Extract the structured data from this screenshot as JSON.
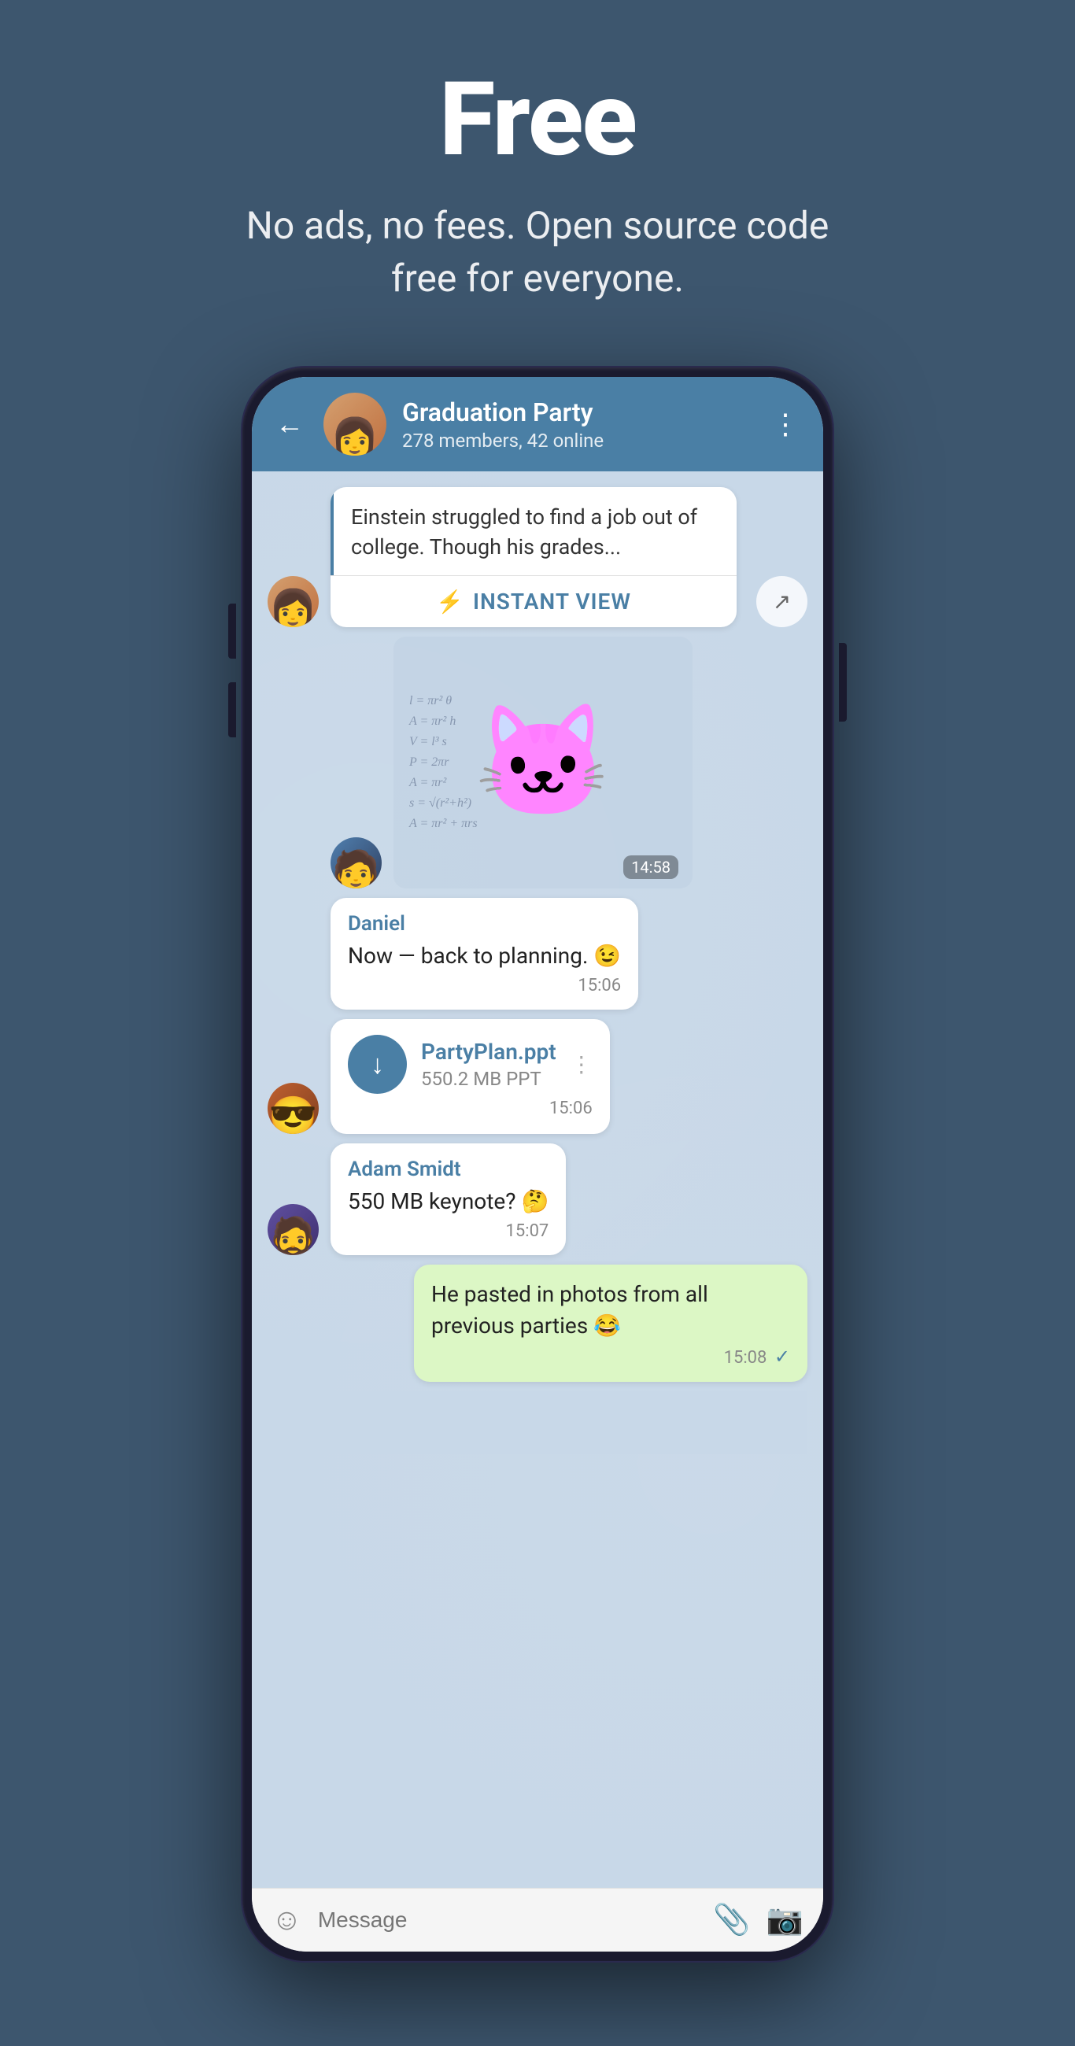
{
  "hero": {
    "title": "Free",
    "subtitle": "No ads, no fees. Open source code free for everyone."
  },
  "phone": {
    "header": {
      "group_name": "Graduation Party",
      "members_info": "278 members, 42 online",
      "back_label": "←",
      "more_label": "⋮"
    },
    "messages": [
      {
        "id": "article-msg",
        "type": "article",
        "avatar": "female",
        "article_text": "Einstein struggled to find a job out of college. Though his grades...",
        "instant_view_label": "INSTANT VIEW"
      },
      {
        "id": "sticker-msg",
        "type": "sticker",
        "avatar": "male-hoodie",
        "emoji": "🐱",
        "time": "14:58"
      },
      {
        "id": "daniel-msg",
        "type": "text",
        "sender": "Daniel",
        "text": "Now — back to planning. 😉",
        "time": "15:06",
        "avatar": null
      },
      {
        "id": "file-msg",
        "type": "file",
        "avatar": "male-sunglasses",
        "file_name": "PartyPlan.ppt",
        "file_size": "550.2 MB PPT",
        "time": "15:06"
      },
      {
        "id": "adam-msg",
        "type": "text",
        "sender": "Adam Smidt",
        "avatar": "male-hat",
        "text": "550 MB keynote? 🤔",
        "time": "15:07"
      },
      {
        "id": "own-msg",
        "type": "own",
        "text": "He pasted in photos from all previous parties 😂",
        "time": "15:08"
      }
    ],
    "input_bar": {
      "placeholder": "Message"
    }
  },
  "math_lines": [
    "l = πr²",
    "A = πr²",
    "V = l³",
    "P = 2πr",
    "A = πr²",
    "s = √(r²+h²)",
    "A = πr² + πrs"
  ]
}
